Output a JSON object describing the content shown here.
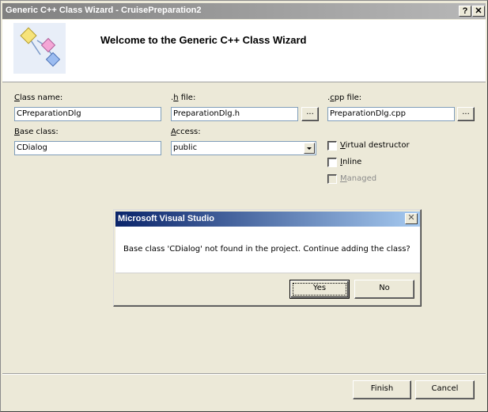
{
  "window": {
    "title": "Generic C++ Class Wizard - CruisePreparation2",
    "help_label": "?",
    "close_label": "✕"
  },
  "header": {
    "title": "Welcome to the Generic C++ Class Wizard",
    "logo_icon": "class-wizard-logo-icon"
  },
  "form": {
    "class_name": {
      "label_accel": "C",
      "label_rest": "lass name:",
      "value": "CPreparationDlg"
    },
    "h_file": {
      "label_pre": ".",
      "label_accel": "h",
      "label_rest": " file:",
      "value": "PreparationDlg.h",
      "browse_label": "..."
    },
    "cpp_file": {
      "label_pre": ".",
      "label_accel": "c",
      "label_rest": "pp file:",
      "value": "PreparationDlg.cpp",
      "browse_label": "..."
    },
    "base_class": {
      "label_accel": "B",
      "label_rest": "ase class:",
      "value": "CDialog"
    },
    "access": {
      "label_accel": "A",
      "label_rest": "ccess:",
      "value": "public"
    },
    "virtual_destructor": {
      "label_accel": "V",
      "label_rest": "irtual destructor",
      "checked": false,
      "enabled": true
    },
    "inline": {
      "label_accel": "I",
      "label_rest": "nline",
      "checked": false,
      "enabled": true
    },
    "managed": {
      "label_accel": "M",
      "label_rest": "anaged",
      "checked": false,
      "enabled": false
    }
  },
  "footer": {
    "finish_label": "Finish",
    "cancel_label": "Cancel"
  },
  "message_box": {
    "title": "Microsoft Visual Studio",
    "close_label": "✕",
    "text": "Base class 'CDialog' not found in the project. Continue adding the class?",
    "yes_label": "Yes",
    "no_label": "No"
  },
  "colors": {
    "dialog_face": "#ece9d8",
    "active_title_start": "#0a246a",
    "active_title_end": "#a6caf0",
    "inactive_title": "#808080"
  }
}
